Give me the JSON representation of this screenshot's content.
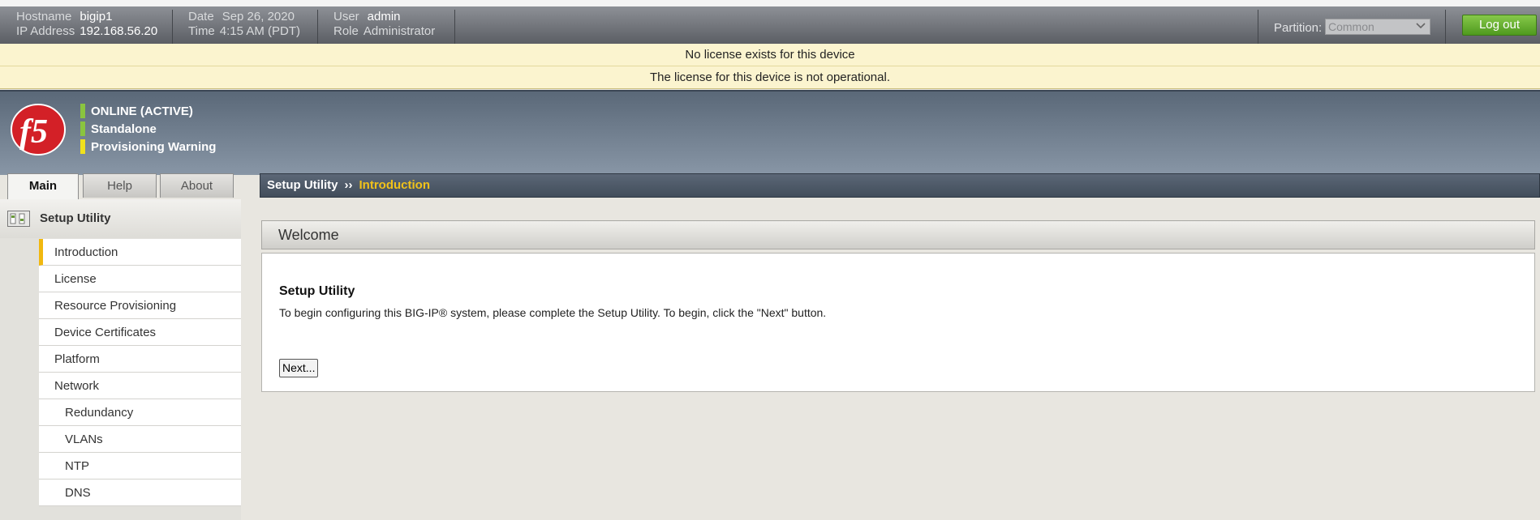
{
  "header": {
    "hostname_label": "Hostname",
    "hostname": "bigip1",
    "ip_label": "IP Address",
    "ip": "192.168.56.20",
    "date_label": "Date",
    "date": "Sep 26, 2020",
    "time_label": "Time",
    "time": "4:15 AM (PDT)",
    "user_label": "User",
    "user": "admin",
    "role_label": "Role",
    "role": "Administrator",
    "partition_label": "Partition:",
    "partition_value": "Common",
    "logout_label": "Log out"
  },
  "alerts": [
    "No license exists for this device",
    "The license for this device is not operational."
  ],
  "status": [
    {
      "label": "ONLINE (ACTIVE)",
      "color": "#8ac43f"
    },
    {
      "label": "Standalone",
      "color": "#8ac43f"
    },
    {
      "label": "Provisioning Warning",
      "color": "#f0e11c"
    }
  ],
  "tabs": {
    "main": "Main",
    "help": "Help",
    "about": "About"
  },
  "breadcrumb": {
    "parent": "Setup Utility",
    "separator": "››",
    "current": "Introduction"
  },
  "sidebar": {
    "title": "Setup Utility",
    "items": [
      {
        "label": "Introduction"
      },
      {
        "label": "License"
      },
      {
        "label": "Resource Provisioning"
      },
      {
        "label": "Device Certificates"
      },
      {
        "label": "Platform"
      },
      {
        "label": "Network"
      },
      {
        "label": "Redundancy"
      },
      {
        "label": "VLANs"
      },
      {
        "label": "NTP"
      },
      {
        "label": "DNS"
      }
    ]
  },
  "main": {
    "panel_title": "Welcome",
    "section_title": "Setup Utility",
    "description": "To begin configuring this BIG-IP® system, please complete the Setup Utility. To begin, click the \"Next\" button.",
    "next_label": "Next..."
  },
  "colors": {
    "accent_yellow": "#f1c21a",
    "logout_green": "#5aa524",
    "brand_red": "#d32027"
  }
}
